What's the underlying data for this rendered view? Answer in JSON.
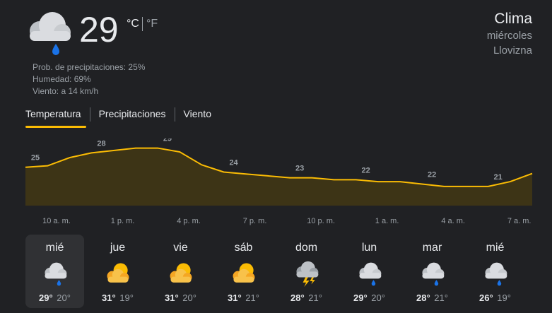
{
  "current": {
    "temperature": "29",
    "unit_c": "°C",
    "unit_f": "°F",
    "icon": "cloud-drizzle-icon",
    "precipitation": "Prob. de precipitaciones: 25%",
    "humidity": "Humedad: 69%",
    "wind": "Viento: a 14 km/h"
  },
  "header": {
    "title": "Clima",
    "day": "miércoles",
    "condition": "Llovizna"
  },
  "tabs": [
    {
      "label": "Temperatura",
      "selected": true
    },
    {
      "label": "Precipitaciones",
      "selected": false
    },
    {
      "label": "Viento",
      "selected": false
    }
  ],
  "chart_data": {
    "type": "area",
    "x": [
      "10 a. m.",
      "11 a. m.",
      "12 p. m.",
      "1 p. m.",
      "2 p. m.",
      "3 p. m.",
      "4 p. m.",
      "5 p. m.",
      "6 p. m.",
      "7 p. m.",
      "8 p. m.",
      "9 p. m.",
      "10 p. m.",
      "11 p. m.",
      "12 a. m.",
      "1 a. m.",
      "2 a. m.",
      "3 a. m.",
      "4 a. m.",
      "5 a. m.",
      "6 a. m.",
      "7 a. m.",
      "8 a. m.",
      "9 a. m."
    ],
    "values": [
      25,
      25.3,
      27,
      28,
      28.5,
      29,
      29,
      28.2,
      25.5,
      24,
      23.6,
      23.2,
      22.8,
      22.8,
      22.4,
      22.4,
      22,
      22,
      21.5,
      21,
      21,
      21,
      22,
      23.7
    ],
    "labeled_indices": [
      0,
      3,
      6,
      9,
      12,
      15,
      18,
      21
    ],
    "tick_labels": [
      "10 a. m.",
      "1 p. m.",
      "4 p. m.",
      "7 p. m.",
      "10 p. m.",
      "1 a. m.",
      "4 a. m.",
      "7 a. m."
    ],
    "ylim": [
      17,
      31
    ],
    "line_color": "#fbbc04",
    "fill_color": "#3d3416"
  },
  "days": [
    {
      "name": "mié",
      "icon": "cloud-drizzle-icon",
      "hi": "29°",
      "lo": "20°",
      "selected": true
    },
    {
      "name": "jue",
      "icon": "partly-sunny-icon",
      "hi": "31°",
      "lo": "19°",
      "selected": false
    },
    {
      "name": "vie",
      "icon": "partly-sunny-icon",
      "hi": "31°",
      "lo": "20°",
      "selected": false
    },
    {
      "name": "sáb",
      "icon": "partly-sunny-icon",
      "hi": "31°",
      "lo": "21°",
      "selected": false
    },
    {
      "name": "dom",
      "icon": "thunderstorm-icon",
      "hi": "28°",
      "lo": "21°",
      "selected": false
    },
    {
      "name": "lun",
      "icon": "cloud-drizzle-icon",
      "hi": "29°",
      "lo": "20°",
      "selected": false
    },
    {
      "name": "mar",
      "icon": "cloud-drizzle-icon",
      "hi": "28°",
      "lo": "21°",
      "selected": false
    },
    {
      "name": "mié",
      "icon": "cloud-drizzle-icon",
      "hi": "26°",
      "lo": "19°",
      "selected": false
    }
  ]
}
